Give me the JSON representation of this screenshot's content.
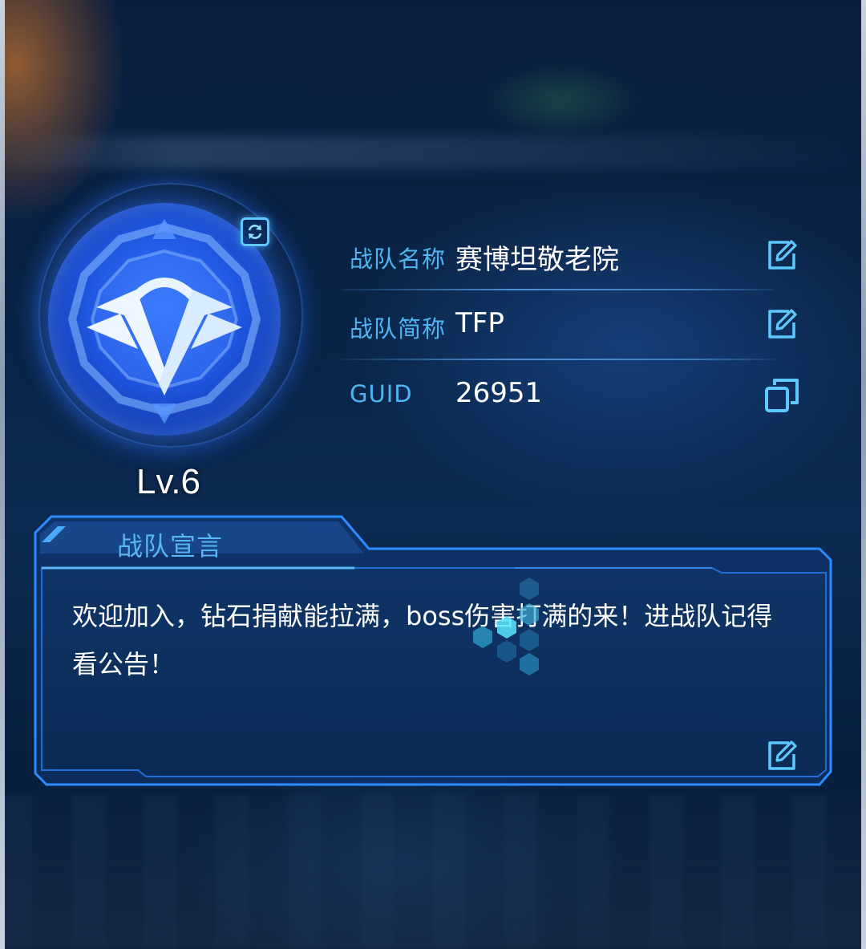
{
  "team": {
    "level": "Lv.6",
    "name_label": "战队名称",
    "name_value": "赛博坦敬老院",
    "abbr_label": "战队简称",
    "abbr_value": "TFP",
    "guid_label": "GUID",
    "guid_value": "26951"
  },
  "declaration": {
    "title": "战队宣言",
    "text": "欢迎加入，钻石捐献能拉满，boss伤害打满的来！进战队记得看公告！"
  },
  "icons": {
    "emblem": "v-emblem-icon",
    "swap": "swap-icon",
    "edit": "edit-icon",
    "copy": "copy-icon"
  },
  "colors": {
    "accent": "#4fb4f2",
    "panel_border": "#2a86f0",
    "panel_fill": "#0c2a55",
    "emblem_blue": "#2a62f0"
  }
}
